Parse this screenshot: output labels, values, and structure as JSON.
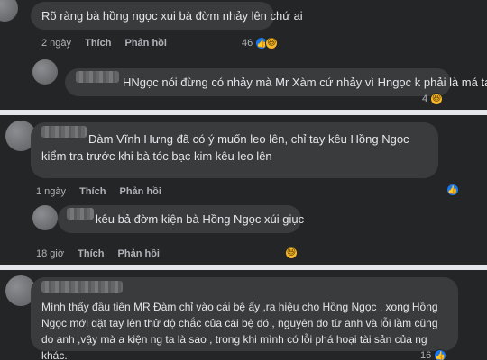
{
  "comments": [
    {
      "text": "Rõ ràng bà hồng ngọc xui bà đờm nhảy lên chứ ai",
      "time": "2 ngày",
      "like": "Thích",
      "reply": "Phản hồi",
      "reaction_count": "46",
      "reactions": [
        "like-icon",
        "haha-icon"
      ]
    },
    {
      "text": "HNgọc nói đừng có nhảy mà Mr Xàm cứ nhảy vì Hngọc k phải là má tao",
      "reaction_count": "4",
      "reactions": [
        "haha-icon"
      ]
    },
    {
      "text": "Đàm Vĩnh Hưng đã có ý muốn leo lên, chỉ tay kêu Hồng Ngọc kiểm tra trước khi bà tóc bạc kim kêu leo lên",
      "time": "1 ngày",
      "like": "Thích",
      "reply": "Phản hồi",
      "reactions": [
        "like-icon"
      ]
    },
    {
      "text": "kêu bả đờm kiện bà Hồng Ngọc xúi giục",
      "time": "18 giờ",
      "like": "Thích",
      "reply": "Phản hồi",
      "reactions": [
        "haha-icon"
      ]
    },
    {
      "text": "Mình thấy đầu tiên MR Đàm chỉ vào cái bệ ấy ,ra hiệu cho Hồng Ngọc , xong Hồng Ngọc mới đặt tay lên thử độ chắc của cái bệ đó , nguyên do từ anh và lỗi lầm cũng do anh ,vậy mà a kiện ng ta là sao , trong khi mình có lỗi phá hoại tài sản của ng khác.",
      "reaction_count": "16",
      "reactions": [
        "like-icon"
      ]
    }
  ],
  "colors": {
    "panel": "#242526",
    "bubble": "#3a3b3c",
    "like": "#1877f2",
    "haha": "#f7b928"
  }
}
